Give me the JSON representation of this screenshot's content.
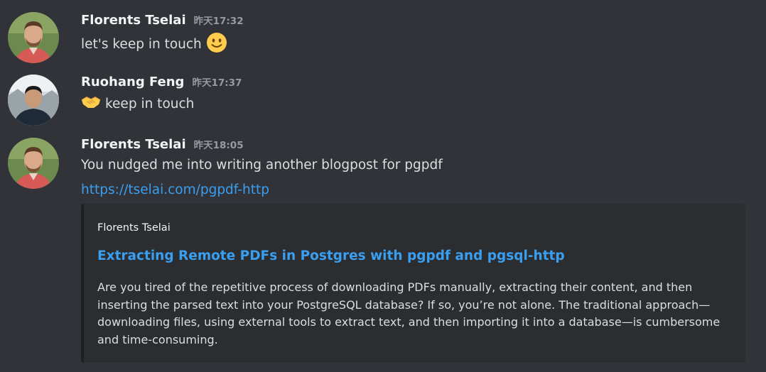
{
  "messages": [
    {
      "author": "Florents Tselai",
      "timestamp": "昨天17:32",
      "text": "let's keep in touch",
      "emoji": "slightly-smiling-face"
    },
    {
      "author": "Ruohang Feng",
      "timestamp": "昨天17:37",
      "emoji": "handshake",
      "text": "keep in touch"
    },
    {
      "author": "Florents Tselai",
      "timestamp": "昨天18:05",
      "text": "You nudged me into writing another blogpost for pgpdf",
      "link": "https://tselai.com/pgpdf-http",
      "embed": {
        "author": "Florents Tselai",
        "title": "Extracting Remote PDFs in Postgres with pgpdf and pgsql-http",
        "description": "Are you tired of the repetitive process of downloading PDFs manually, extracting their content, and then inserting the parsed text into your PostgreSQL database? If so, you’re not alone. The traditional approach—downloading files, using external tools to extract text, and then importing it into a database—is cumbersome and time-consuming."
      }
    }
  ],
  "colors": {
    "background": "#313338",
    "link": "#3a9ff0",
    "embed_bg": "#2b2d31",
    "author": "#f2f3f5",
    "timestamp": "#949ba4"
  }
}
